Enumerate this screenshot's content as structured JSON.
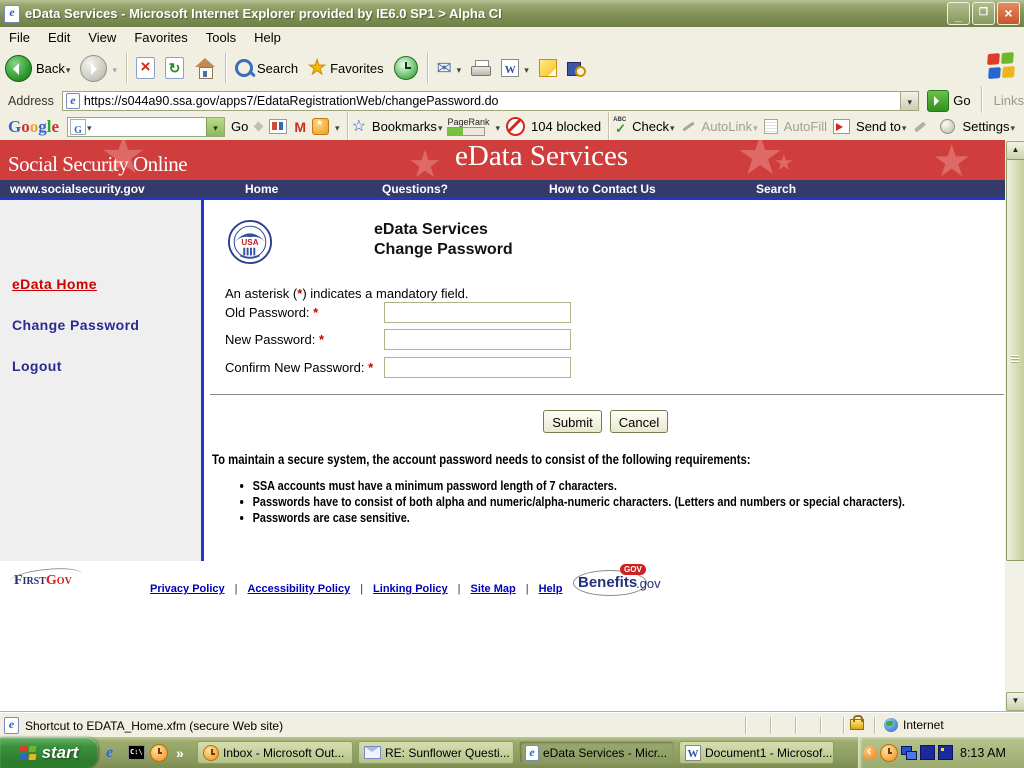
{
  "colors": {
    "titlebar_olive": "#7f8f55",
    "header_red": "#cf3d3d",
    "nav_navy": "#343a6a",
    "accent_blue": "#2434d0",
    "link_red": "#cc0000",
    "link_navy": "#2b2b8f",
    "footer_link_blue": "#0000bb"
  },
  "window": {
    "title": "eData Services - Microsoft Internet Explorer provided by IE6.0 SP1 > Alpha CI",
    "menu": [
      "File",
      "Edit",
      "View",
      "Favorites",
      "Tools",
      "Help"
    ]
  },
  "toolbar": {
    "back": "Back",
    "search": "Search",
    "favorites": "Favorites"
  },
  "address_bar": {
    "label": "Address",
    "url": "https://s044a90.ssa.gov/apps7/EdataRegistrationWeb/changePassword.do",
    "go": "Go",
    "links": "Links"
  },
  "google_toolbar": {
    "logo_letters": [
      "G",
      "o",
      "o",
      "g",
      "l",
      "e"
    ],
    "go": "Go",
    "bookmarks": "Bookmarks",
    "pagerank": "PageRank",
    "blocked": "104 blocked",
    "check": "Check",
    "autolink": "AutoLink",
    "autofill": "AutoFill",
    "send_to": "Send to",
    "settings": "Settings"
  },
  "site_header": {
    "brand": "Social Security Online",
    "title": "eData Services",
    "site_url": "www.socialsecurity.gov",
    "nav": [
      "Home",
      "Questions?",
      "How to Contact Us",
      "Search"
    ]
  },
  "sidebar": {
    "items": [
      "eData Home",
      "Change Password",
      "Logout"
    ]
  },
  "content": {
    "heading_line1": "eData Services",
    "heading_line2": "Change Password",
    "note_pre": "An asterisk (",
    "note_star": "*",
    "note_post": ") indicates a mandatory field.",
    "star": "*",
    "fields": [
      {
        "label": "Old Password:"
      },
      {
        "label": "New Password:"
      },
      {
        "label": "Confirm New Password:"
      }
    ],
    "submit": "Submit",
    "cancel": "Cancel",
    "requirements_intro": "To maintain a secure system, the account password needs to consist of the following requirements:",
    "requirements": [
      "SSA accounts must have a minimum password length of 7 characters.",
      "Passwords have to consist of both alpha and numeric/alpha-numeric characters. (Letters and numbers or special characters).",
      "Passwords are case sensitive."
    ]
  },
  "footer": {
    "firstgov_first": "First",
    "firstgov_gov": "Gov",
    "separator": "|",
    "links": [
      "Privacy Policy",
      "Accessibility Policy",
      "Linking Policy",
      "Site Map",
      "Help"
    ],
    "benefits_badge": "GOV",
    "benefits_name": "Benefits",
    "benefits_suffix": ".gov"
  },
  "status_bar": {
    "text": "Shortcut to EDATA_Home.xfm (secure Web site)",
    "zone": "Internet"
  },
  "taskbar": {
    "start": "start",
    "tasks": [
      "Inbox - Microsoft Out...",
      "RE: Sunflower Questi...",
      "eData Services - Micr...",
      "Document1 - Microsof..."
    ],
    "time": "8:13 AM"
  },
  "icons": {
    "seal_text": "USA"
  }
}
